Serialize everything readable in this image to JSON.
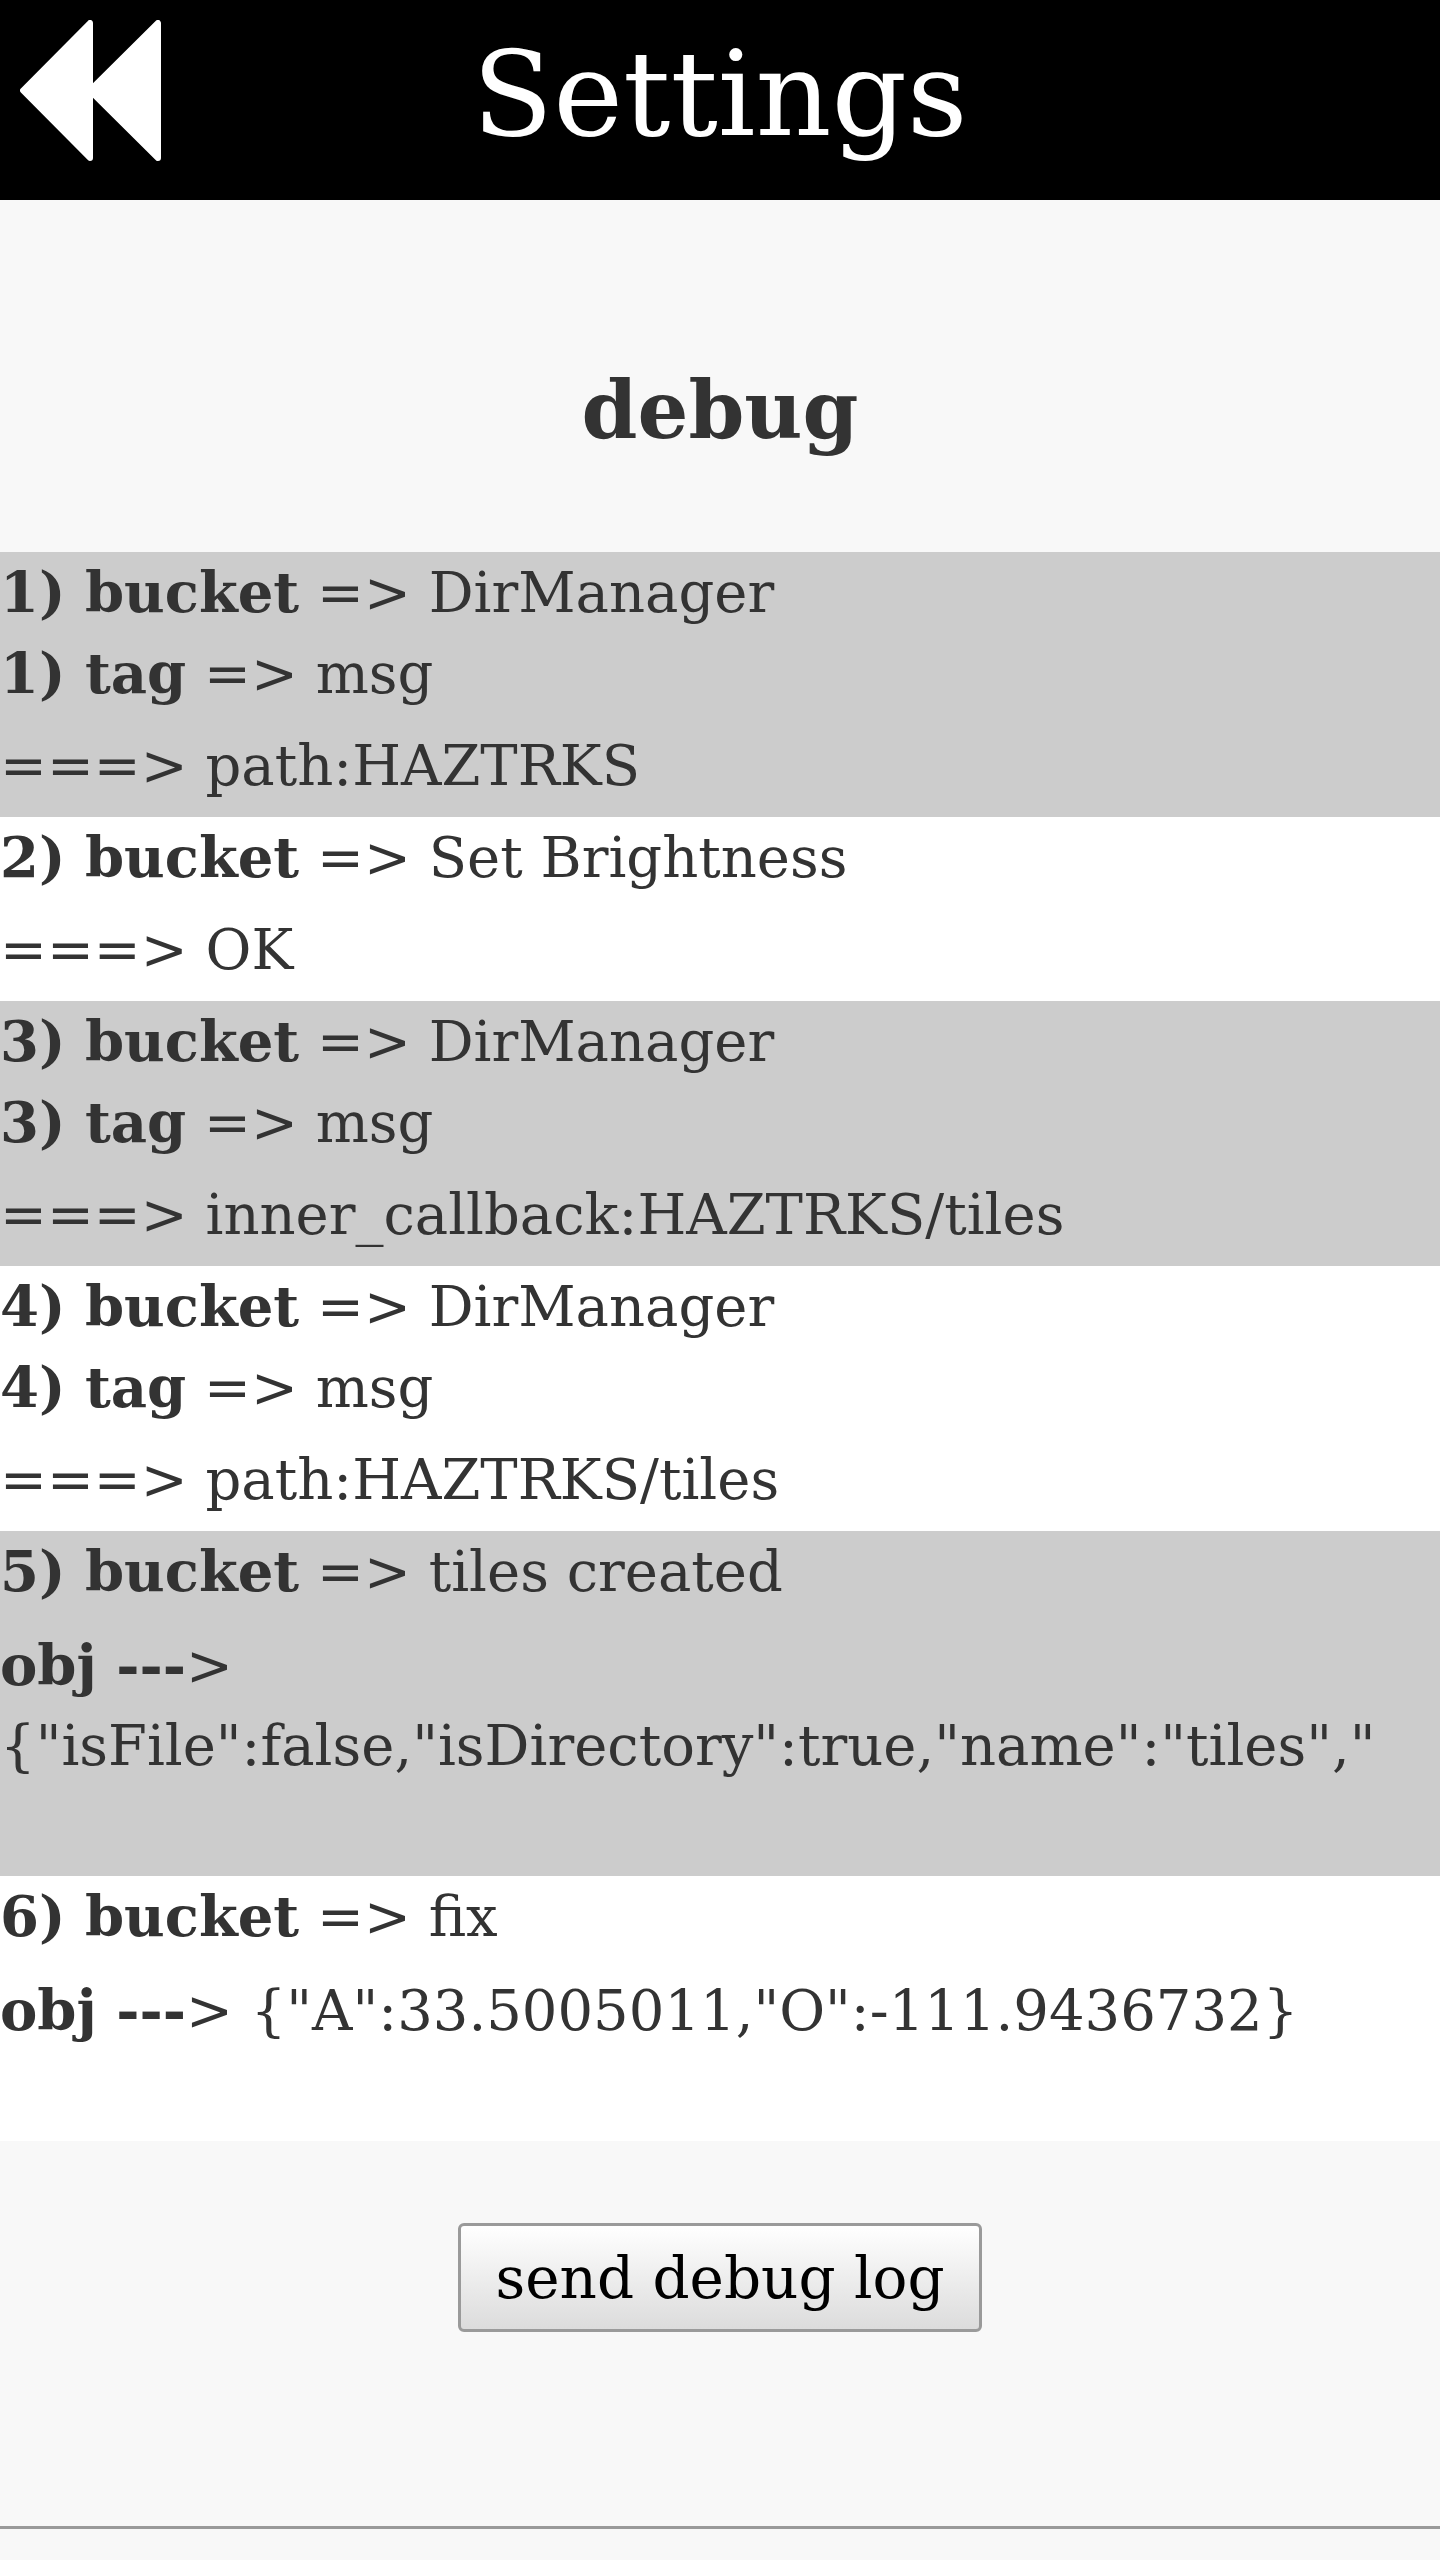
{
  "header": {
    "title": "Settings"
  },
  "section": {
    "heading": "debug"
  },
  "log_entries": [
    {
      "lines": [
        "**1) bucket** => DirManager",
        "**1) tag** => msg"
      ],
      "result": {
        "kind": "status",
        "text": "===> path:HAZTRKS"
      }
    },
    {
      "lines": [
        "**2) bucket** => Set Brightness"
      ],
      "result": {
        "kind": "status",
        "text": "===> OK"
      }
    },
    {
      "lines": [
        "**3) bucket** => DirManager",
        "**3) tag** => msg"
      ],
      "result": {
        "kind": "status",
        "text": "===> inner_callback:HAZTRKS/tiles"
      }
    },
    {
      "lines": [
        "**4) bucket** => DirManager",
        "**4) tag** => msg"
      ],
      "result": {
        "kind": "status",
        "text": "===> path:HAZTRKS/tiles"
      }
    },
    {
      "lines": [
        "**5) bucket** => tiles created"
      ],
      "result": {
        "kind": "object",
        "text": "**obj ---**> {\"isFile\":false,\"isDirectory\":true,\"name\":\"tiles\",\""
      }
    },
    {
      "lines": [
        "**6) bucket** => fix"
      ],
      "result": {
        "kind": "object",
        "text": "**obj ---**> {\"A\":33.5005011,\"O\":-111.9436732}"
      }
    }
  ],
  "button": {
    "label": "send debug log"
  }
}
